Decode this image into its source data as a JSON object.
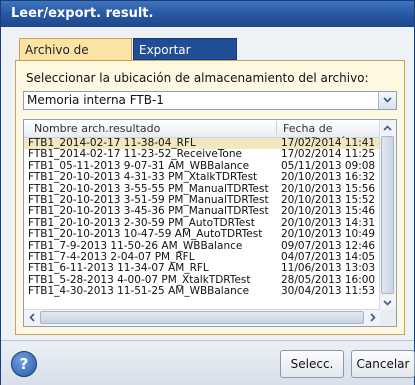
{
  "window": {
    "title": "Leer/export. result."
  },
  "tabs": [
    {
      "label": "Archivo de resultado",
      "active": true
    },
    {
      "label": "Exportar resultados",
      "active": false
    }
  ],
  "location": {
    "label": "Seleccionar la ubicación de almacenamiento del archivo:",
    "selected": "Memoria interna FTB-1"
  },
  "file_list": {
    "columns": [
      "Nombre arch.resultado",
      "Fecha de modificación"
    ],
    "rows": [
      [
        "FTB1_2014-02-17 11-38-04_RFL",
        "17/02/2014 11:41"
      ],
      [
        "FTB1_2014-02-17 11-23-52_ReceiveTone",
        "17/02/2014 11:25"
      ],
      [
        "FTB1_05-11-2013 9-07-31 AM_WBBalance",
        "05/11/2013 09:08"
      ],
      [
        "FTB1_20-10-2013 4-31-33 PM_XtalkTDRTest",
        "20/10/2013 16:32"
      ],
      [
        "FTB1_20-10-2013 3-55-55 PM_ManualTDRTest",
        "20/10/2013 15:56"
      ],
      [
        "FTB1_20-10-2013 3-51-59 PM_ManualTDRTest",
        "20/10/2013 15:52"
      ],
      [
        "FTB1_20-10-2013 3-45-36 PM_ManualTDRTest",
        "20/10/2013 15:46"
      ],
      [
        "FTB1_20-10-2013 2-30-59 PM_AutoTDRTest",
        "20/10/2013 14:31"
      ],
      [
        "FTB1_20-10-2013 10-47-59 AM_AutoTDRTest",
        "20/10/2013 10:49"
      ],
      [
        "FTB1_7-9-2013 11-50-26 AM_WBBalance",
        "09/07/2013 12:46"
      ],
      [
        "FTB1_7-4-2013 2-04-07 PM_RFL",
        "04/07/2013 14:05"
      ],
      [
        "FTB1_6-11-2013 11-34-07 AM_RFL",
        "11/06/2013 13:03"
      ],
      [
        "FTB1_5-28-2013 4-00-07 PM_XtalkTDRTest",
        "28/05/2013 16:00"
      ],
      [
        "FTB1_4-30-2013 11-51-25 AM_WBBalance",
        "30/04/2013 11:53"
      ]
    ],
    "selected_index": 0
  },
  "buttons": {
    "help": "?",
    "select": "Selecc.",
    "cancel": "Cancelar"
  },
  "colors": {
    "titlebar": "#2a5aa6",
    "active_tab": "#fbe3a3",
    "selection": "#f3e7bf"
  }
}
